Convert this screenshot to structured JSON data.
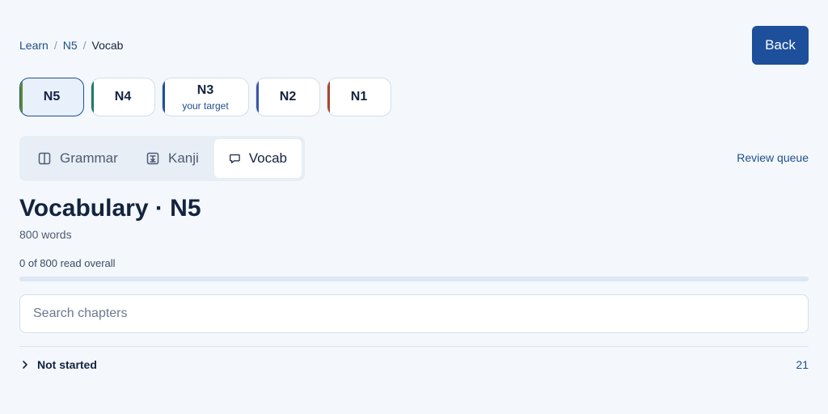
{
  "breadcrumb": {
    "items": [
      "Learn",
      "N5"
    ],
    "separator": "/",
    "current": "Vocab"
  },
  "header": {
    "back_label": "Back"
  },
  "levels": [
    {
      "code": "N5",
      "sublabel": "",
      "active": true,
      "accent": "#5a8a2e"
    },
    {
      "code": "N4",
      "sublabel": "",
      "active": false,
      "accent": "#1f7a6a"
    },
    {
      "code": "N3",
      "sublabel": "your target",
      "active": false,
      "accent": "#1d4f9b"
    },
    {
      "code": "N2",
      "sublabel": "",
      "active": false,
      "accent": "#3a55a8"
    },
    {
      "code": "N1",
      "sublabel": "",
      "active": false,
      "accent": "#a8472a"
    }
  ],
  "tabs": [
    {
      "label": "Grammar",
      "icon": "book-icon",
      "active": false
    },
    {
      "label": "Kanji",
      "icon": "kanji-icon",
      "active": false
    },
    {
      "label": "Vocab",
      "icon": "speech-bubble-icon",
      "active": true
    }
  ],
  "review_link": "Review queue",
  "main": {
    "title": "Vocabulary · N5",
    "word_count": "800 words",
    "progress_text": "0 of 800 read overall",
    "progress_fraction": 0
  },
  "search": {
    "placeholder": "Search chapters",
    "value": ""
  },
  "groups": [
    {
      "label": "Not started",
      "count": "21",
      "expanded": false
    }
  ],
  "colors": {
    "primary": "#1d4f9b",
    "background": "#f4f8fc",
    "text": "#13233f",
    "link": "#1e4e8c"
  }
}
